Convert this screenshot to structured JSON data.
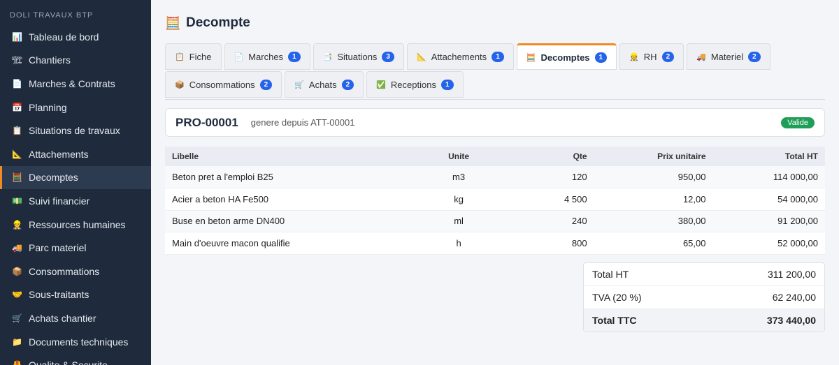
{
  "sidebar": {
    "brand": "DOLI TRAVAUX BTP",
    "items": [
      {
        "label": "Tableau de bord",
        "icon": "📊",
        "name": "sidebar-item-tableau-de-bord"
      },
      {
        "label": "Chantiers",
        "icon": "🏗",
        "name": "sidebar-item-chantiers"
      },
      {
        "label": "Marches & Contrats",
        "icon": "📄",
        "name": "sidebar-item-marches-contrats"
      },
      {
        "label": "Planning",
        "icon": "📅",
        "name": "sidebar-item-planning"
      },
      {
        "label": "Situations de travaux",
        "icon": "📋",
        "name": "sidebar-item-situations"
      },
      {
        "label": "Attachements",
        "icon": "📐",
        "name": "sidebar-item-attachements"
      },
      {
        "label": "Decomptes",
        "icon": "🧮",
        "name": "sidebar-item-decomptes"
      },
      {
        "label": "Suivi financier",
        "icon": "💵",
        "name": "sidebar-item-suivi-financier"
      },
      {
        "label": "Ressources humaines",
        "icon": "👷",
        "name": "sidebar-item-rh"
      },
      {
        "label": "Parc materiel",
        "icon": "🚚",
        "name": "sidebar-item-parc-materiel"
      },
      {
        "label": "Consommations",
        "icon": "📦",
        "name": "sidebar-item-consommations"
      },
      {
        "label": "Sous-traitants",
        "icon": "🤝",
        "name": "sidebar-item-sous-traitants"
      },
      {
        "label": "Achats chantier",
        "icon": "🛒",
        "name": "sidebar-item-achats-chantier"
      },
      {
        "label": "Documents techniques",
        "icon": "📁",
        "name": "sidebar-item-documents"
      },
      {
        "label": "Qualite & Securite",
        "icon": "🦺",
        "name": "sidebar-item-qualite-securite"
      }
    ],
    "active_index": 6
  },
  "page": {
    "title": "Decompte",
    "title_icon": "🧮"
  },
  "tabs": [
    {
      "label": "Fiche",
      "icon": "📋",
      "badge": null,
      "name": "tab-fiche"
    },
    {
      "label": "Marches",
      "icon": "📄",
      "badge": "1",
      "name": "tab-marches"
    },
    {
      "label": "Situations",
      "icon": "📑",
      "badge": "3",
      "name": "tab-situations"
    },
    {
      "label": "Attachements",
      "icon": "📐",
      "badge": "1",
      "name": "tab-attachements"
    },
    {
      "label": "Decomptes",
      "icon": "🧮",
      "badge": "1",
      "name": "tab-decomptes"
    },
    {
      "label": "RH",
      "icon": "👷",
      "badge": "2",
      "name": "tab-rh"
    },
    {
      "label": "Materiel",
      "icon": "🚚",
      "badge": "2",
      "name": "tab-materiel"
    },
    {
      "label": "Consommations",
      "icon": "📦",
      "badge": "2",
      "name": "tab-consommations"
    },
    {
      "label": "Achats",
      "icon": "🛒",
      "badge": "2",
      "name": "tab-achats"
    },
    {
      "label": "Receptions",
      "icon": "✅",
      "badge": "1",
      "name": "tab-receptions"
    }
  ],
  "active_tab": 4,
  "document": {
    "ref": "PRO-00001",
    "subtitle": "genere depuis ATT-00001",
    "status": "Valide",
    "status_color": "#1e9e57"
  },
  "table": {
    "headers": [
      "Libelle",
      "Unite",
      "Qte",
      "Prix unitaire",
      "Total HT"
    ],
    "rows": [
      [
        "Beton pret a l'emploi B25",
        "m3",
        "120",
        "950,00",
        "114 000,00"
      ],
      [
        "Acier a beton HA Fe500",
        "kg",
        "4 500",
        "12,00",
        "54 000,00"
      ],
      [
        "Buse en beton arme DN400",
        "ml",
        "240",
        "380,00",
        "91 200,00"
      ],
      [
        "Main d'oeuvre macon qualifie",
        "h",
        "800",
        "65,00",
        "52 000,00"
      ]
    ]
  },
  "totals": [
    {
      "label": "Total HT",
      "value": "311 200,00"
    },
    {
      "label": "TVA (20 %)",
      "value": "62 240,00"
    },
    {
      "label": "Total TTC",
      "value": "373 440,00"
    }
  ],
  "colors": {
    "accent": "#f08a24",
    "badge": "#2563eb",
    "sidebar": "#1f2b3d"
  }
}
